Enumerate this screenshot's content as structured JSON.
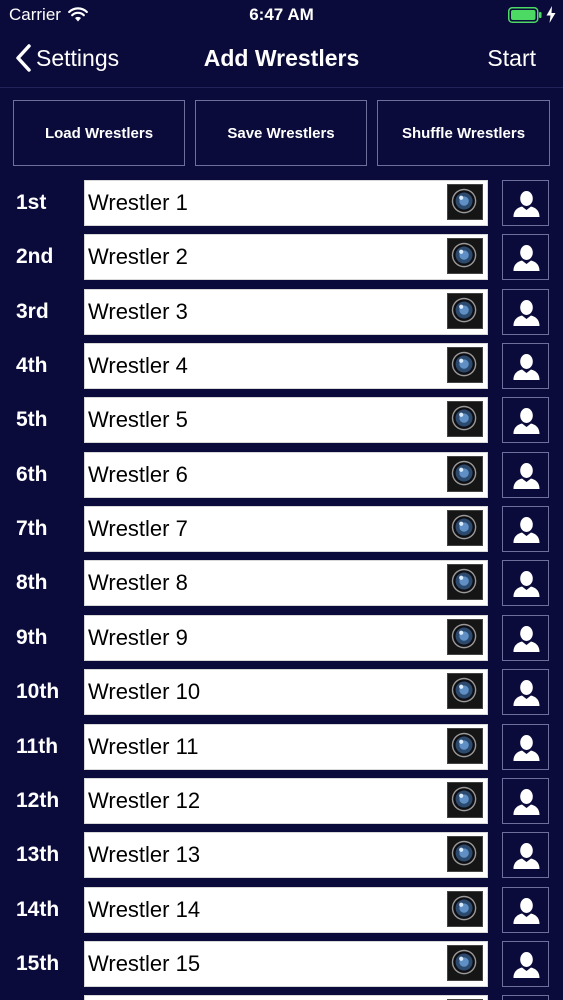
{
  "status_bar": {
    "carrier": "Carrier",
    "time": "6:47 AM"
  },
  "nav": {
    "back_label": "Settings",
    "title": "Add Wrestlers",
    "start_label": "Start"
  },
  "actions": {
    "load": "Load Wrestlers",
    "save": "Save Wrestlers",
    "shuffle": "Shuffle Wrestlers"
  },
  "wrestlers": [
    {
      "rank": "1st",
      "name": "Wrestler 1"
    },
    {
      "rank": "2nd",
      "name": "Wrestler 2"
    },
    {
      "rank": "3rd",
      "name": "Wrestler 3"
    },
    {
      "rank": "4th",
      "name": "Wrestler 4"
    },
    {
      "rank": "5th",
      "name": "Wrestler 5"
    },
    {
      "rank": "6th",
      "name": "Wrestler 6"
    },
    {
      "rank": "7th",
      "name": "Wrestler 7"
    },
    {
      "rank": "8th",
      "name": "Wrestler 8"
    },
    {
      "rank": "9th",
      "name": "Wrestler 9"
    },
    {
      "rank": "10th",
      "name": "Wrestler 10"
    },
    {
      "rank": "11th",
      "name": "Wrestler 11"
    },
    {
      "rank": "12th",
      "name": "Wrestler 12"
    },
    {
      "rank": "13th",
      "name": "Wrestler 13"
    },
    {
      "rank": "14th",
      "name": "Wrestler 14"
    },
    {
      "rank": "15th",
      "name": "Wrestler 15"
    },
    {
      "rank": "",
      "name": ""
    }
  ],
  "icons": {
    "camera": "camera-lens-icon",
    "contact": "person-icon",
    "back": "chevron-left-icon",
    "wifi": "wifi-icon",
    "battery": "battery-icon"
  },
  "colors": {
    "background": "#0b0b3b",
    "border": "#6f6f9c",
    "battery": "#4cd964"
  }
}
